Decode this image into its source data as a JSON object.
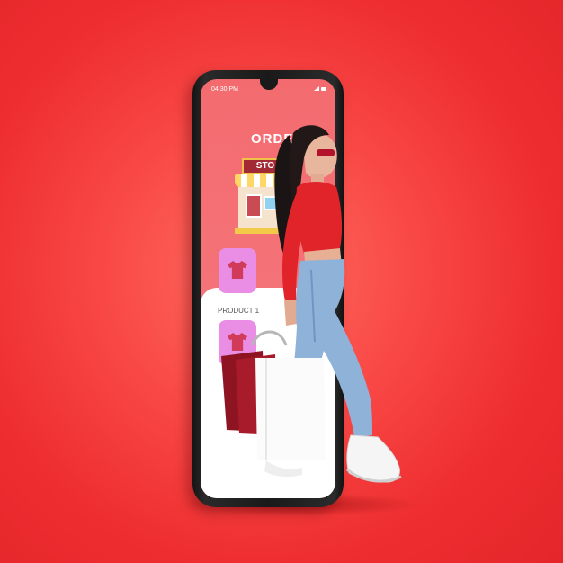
{
  "phone": {
    "status_time": "04:30 PM",
    "app_title": "ORDE",
    "store_sign": "STO",
    "product_label": "PRODUCT 1"
  },
  "colors": {
    "background": "#ee2d30",
    "screen": "#f36b6f",
    "tile": "#e98ee4",
    "top": "#e0242a",
    "jeans": "#8fb2d8"
  },
  "icons": [
    "signal-icon",
    "battery-icon",
    "shirt-icon",
    "store-icon",
    "shopping-bag-icon"
  ]
}
